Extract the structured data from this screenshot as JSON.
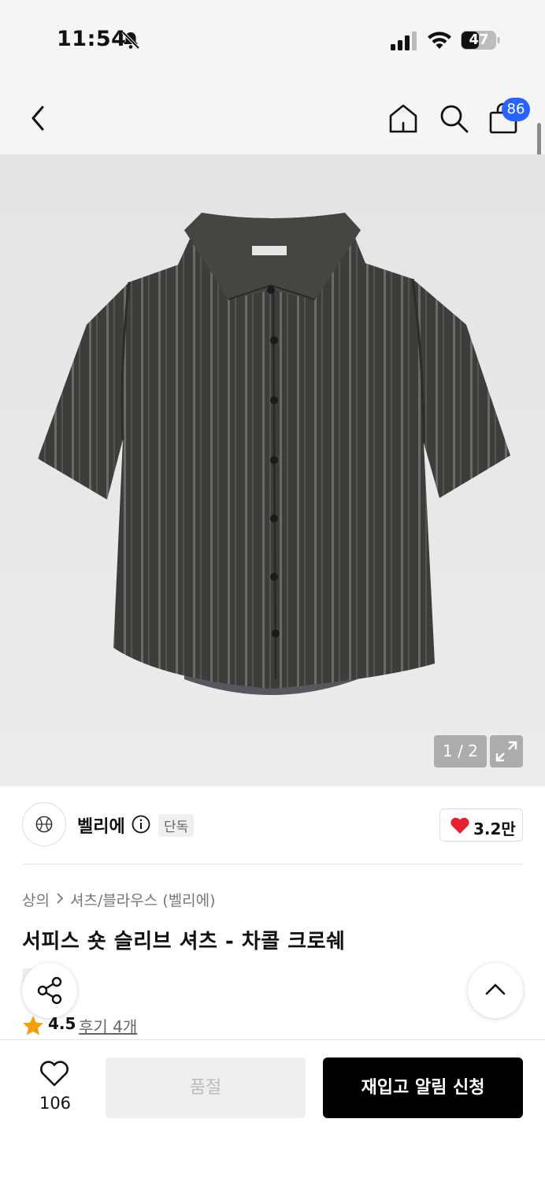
{
  "status_bar": {
    "time": "11:54",
    "battery": "47",
    "icons": [
      "bell-slash-icon",
      "cellular-signal-icon",
      "wifi-icon",
      "battery-icon"
    ]
  },
  "nav": {
    "icons": [
      "chevron-left-icon",
      "home-icon",
      "search-icon",
      "shopping-bag-icon"
    ],
    "cart_count": "86"
  },
  "gallery": {
    "image_subject": "charcoal striped crochet short sleeve shirt",
    "counter": "1 / 2",
    "expand_icon": "expand-icon"
  },
  "brand": {
    "name": "벨리에",
    "tag": "단독",
    "likes": "3.2만",
    "heart_color": "#e8212e"
  },
  "breadcrumb": {
    "level1": "상의",
    "level2": "셔츠/블라우스 (벨리에)"
  },
  "product": {
    "title": "서피스 숏 슬리브 셔츠 - 차콜 크로쉐",
    "tag": "단독",
    "rating": "4.5",
    "reviews": "후기 4개",
    "star_color": "#f5a00a"
  },
  "bottom_bar": {
    "wish_count": "106",
    "soldout_label": "품절",
    "restock_label": "재입고 알림 신청"
  },
  "colors": {
    "accent_badge": "#2962ff",
    "cta": "#000000"
  }
}
